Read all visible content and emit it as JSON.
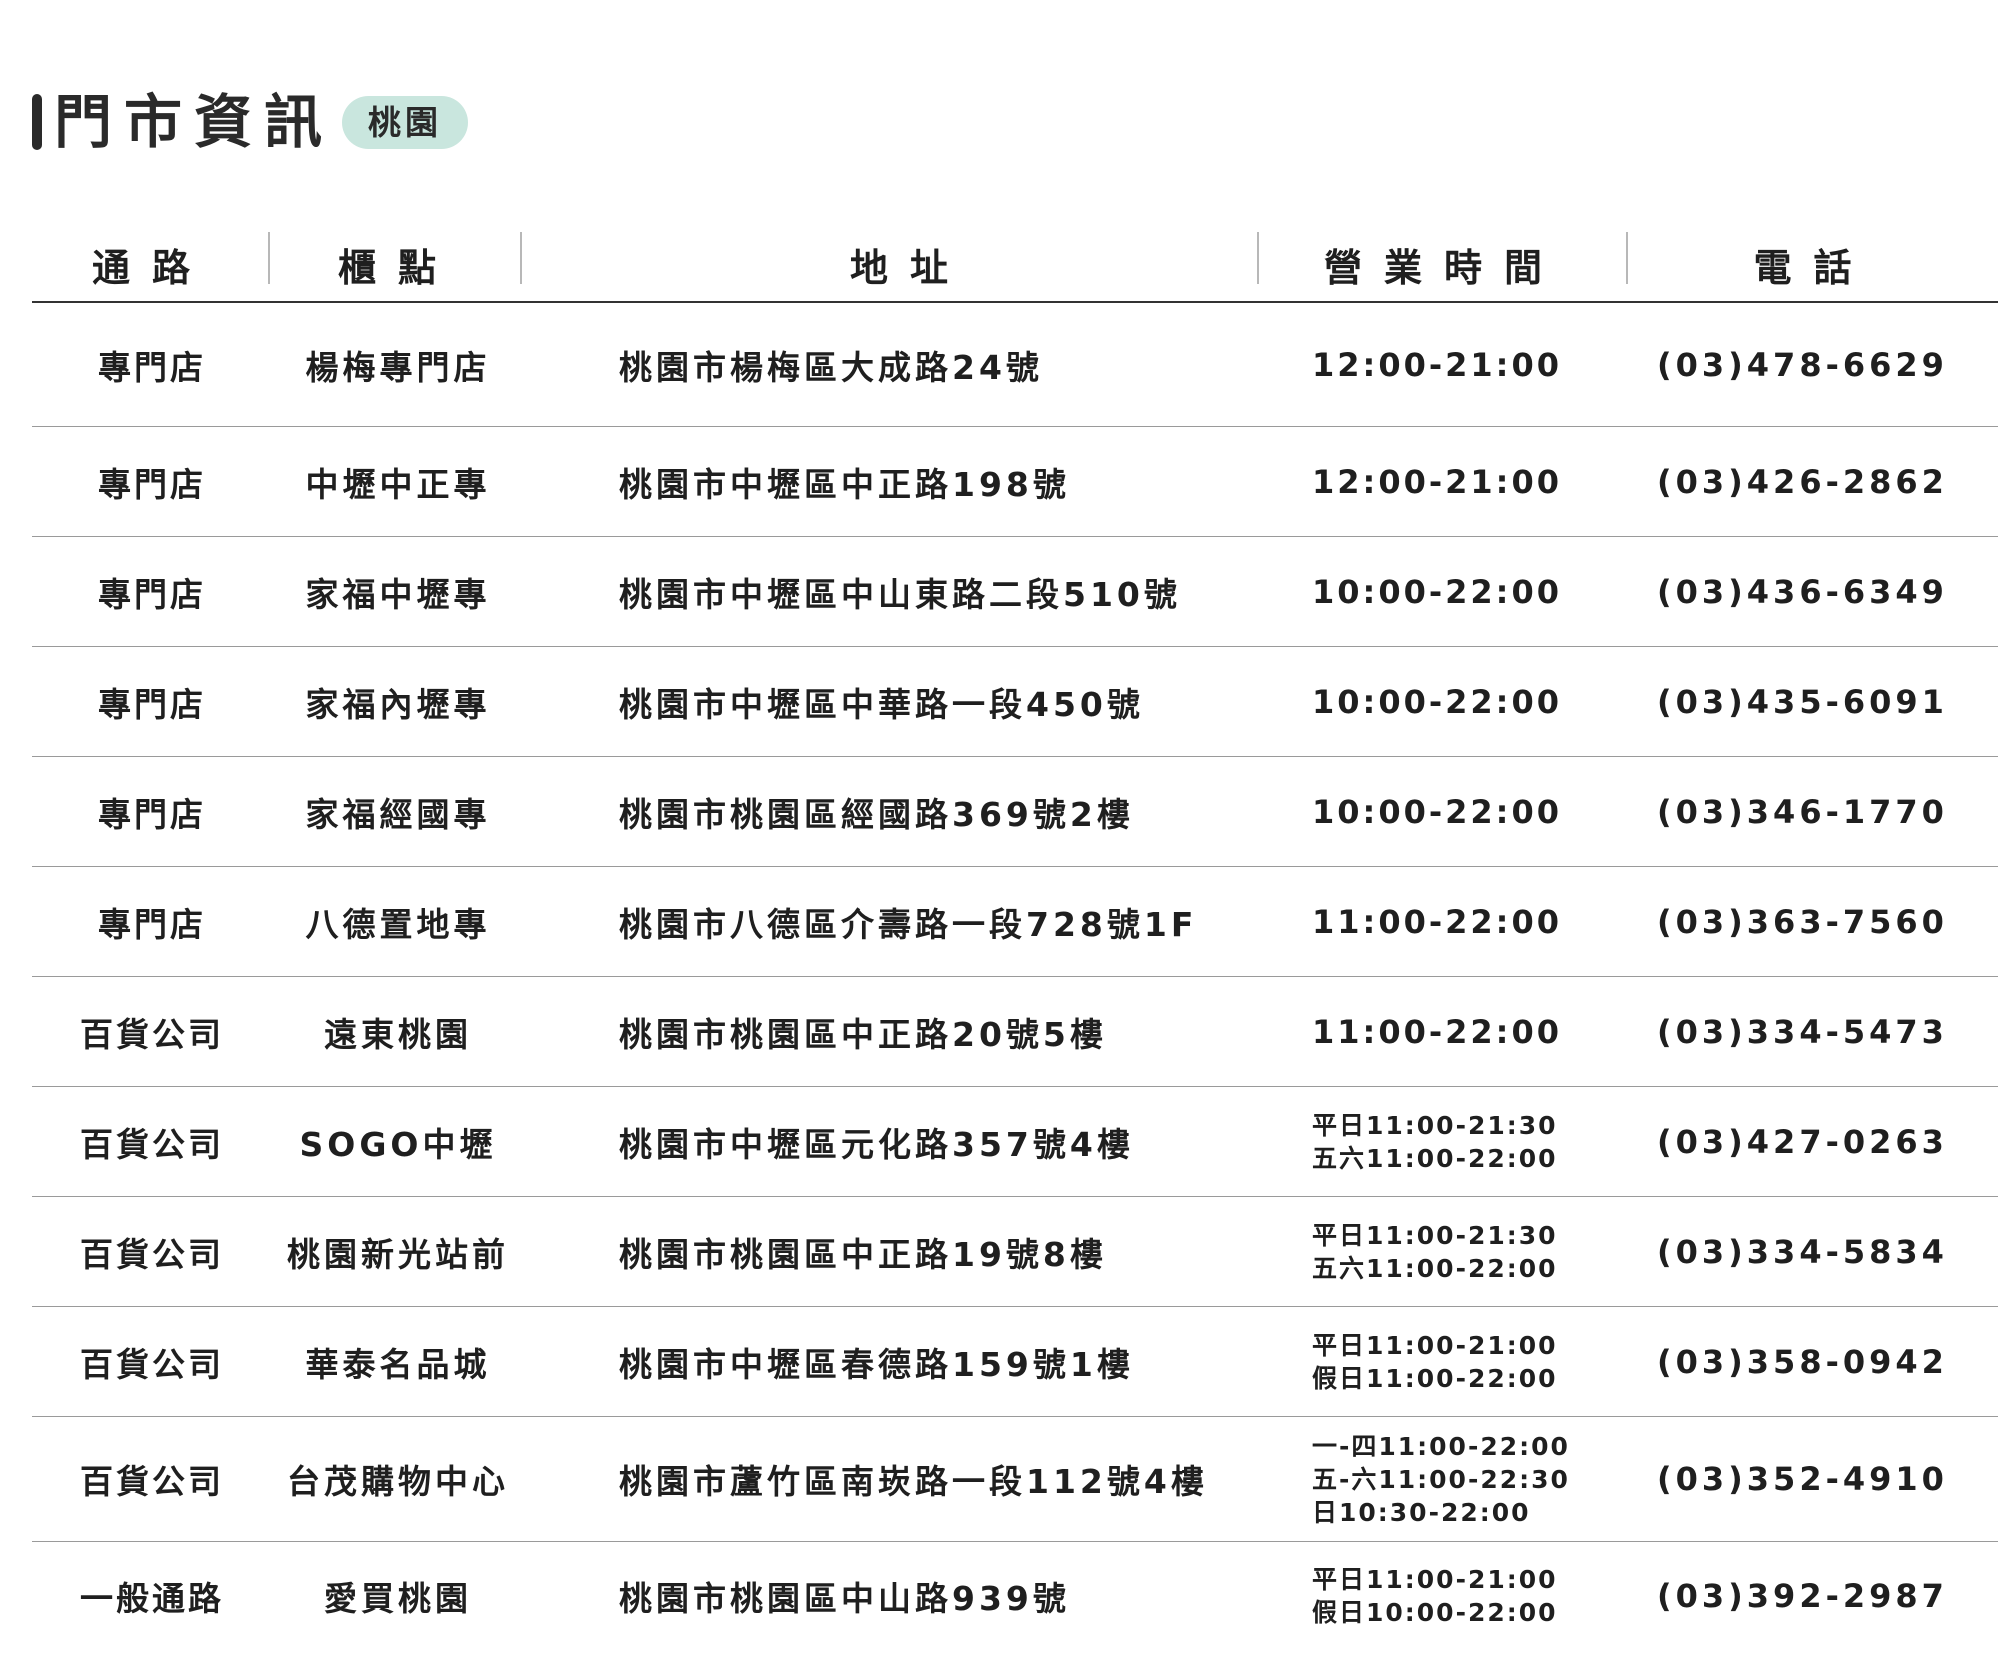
{
  "title": {
    "text": "門市資訊",
    "badge": "桃園"
  },
  "headers": {
    "channel": "通路",
    "store": "櫃點",
    "address": "地址",
    "hours": "營業時間",
    "phone": "電話"
  },
  "rows": [
    {
      "channel": "專門店",
      "store": "楊梅專門店",
      "address": "桃園市楊梅區大成路24號",
      "hours": [
        "12:00-21:00"
      ],
      "phone": "(03)478-6629"
    },
    {
      "channel": "專門店",
      "store": "中壢中正專",
      "address": "桃園市中壢區中正路198號",
      "hours": [
        "12:00-21:00"
      ],
      "phone": "(03)426-2862"
    },
    {
      "channel": "專門店",
      "store": "家福中壢專",
      "address": "桃園市中壢區中山東路二段510號",
      "hours": [
        "10:00-22:00"
      ],
      "phone": "(03)436-6349"
    },
    {
      "channel": "專門店",
      "store": "家福內壢專",
      "address": "桃園市中壢區中華路一段450號",
      "hours": [
        "10:00-22:00"
      ],
      "phone": "(03)435-6091"
    },
    {
      "channel": "專門店",
      "store": "家福經國專",
      "address": "桃園市桃園區經國路369號2樓",
      "hours": [
        "10:00-22:00"
      ],
      "phone": "(03)346-1770"
    },
    {
      "channel": "專門店",
      "store": "八德置地專",
      "address": "桃園市八德區介壽路一段728號1F",
      "hours": [
        "11:00-22:00"
      ],
      "phone": "(03)363-7560"
    },
    {
      "channel": "百貨公司",
      "store": "遠東桃園",
      "address": "桃園市桃園區中正路20號5樓",
      "hours": [
        "11:00-22:00"
      ],
      "phone": "(03)334-5473"
    },
    {
      "channel": "百貨公司",
      "store": "SOGO中壢",
      "address": "桃園市中壢區元化路357號4樓",
      "hours": [
        "平日11:00-21:30",
        "五六11:00-22:00"
      ],
      "phone": "(03)427-0263"
    },
    {
      "channel": "百貨公司",
      "store": "桃園新光站前",
      "address": "桃園市桃園區中正路19號8樓",
      "hours": [
        "平日11:00-21:30",
        "五六11:00-22:00"
      ],
      "phone": "(03)334-5834"
    },
    {
      "channel": "百貨公司",
      "store": "華泰名品城",
      "address": "桃園市中壢區春德路159號1樓",
      "hours": [
        "平日11:00-21:00",
        "假日11:00-22:00"
      ],
      "phone": "(03)358-0942"
    },
    {
      "channel": "百貨公司",
      "store": "台茂購物中心",
      "address": "桃園市蘆竹區南崁路一段112號4樓",
      "hours": [
        "一-四11:00-22:00",
        "五-六11:00-22:30",
        "日10:30-22:00"
      ],
      "phone": "(03)352-4910"
    },
    {
      "channel": "一般通路",
      "store": "愛買桃園",
      "address": "桃園市桃園區中山路939號",
      "hours": [
        "平日11:00-21:00",
        "假日10:00-22:00"
      ],
      "phone": "(03)392-2987"
    }
  ]
}
